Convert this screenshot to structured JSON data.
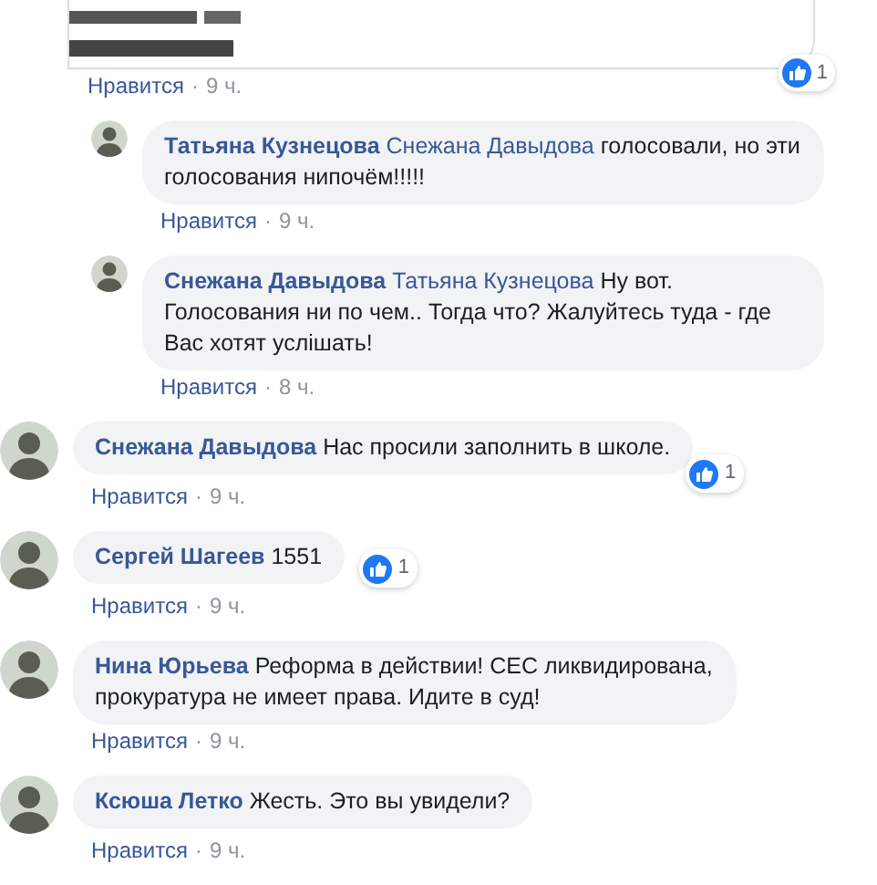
{
  "comments": [
    {
      "kind": "preview",
      "reactions": "1",
      "like": "Нравится",
      "dot": "·",
      "time": "9 ч.",
      "children": [
        {
          "kind": "comment",
          "author": "Татьяна Кузнецова",
          "mention": "Снежана Давыдова",
          "text": "голосовали, но эти голосования нипочём!!!!!",
          "like": "Нравится",
          "dot": "·",
          "time": "9 ч."
        },
        {
          "kind": "comment",
          "author": "Снежана Давыдова",
          "mention": "Татьяна Кузнецова",
          "text": "Ну вот. Голосования ни по чем.. Тогда что? Жалуйтесь туда - где Вас хотят услішать!",
          "like": "Нравится",
          "dot": "·",
          "time": "8 ч."
        }
      ]
    },
    {
      "kind": "comment",
      "author": "Снежана Давыдова",
      "text": "Нас просили заполнить в школе.",
      "reactions": "1",
      "like": "Нравится",
      "dot": "·",
      "time": "9 ч."
    },
    {
      "kind": "comment",
      "author": "Сергей Шагеев",
      "text": "1551",
      "reactions": "1",
      "like": "Нравится",
      "dot": "·",
      "time": "9 ч."
    },
    {
      "kind": "comment",
      "author": "Нина Юрьева",
      "text": "Реформа в действии! СЕС ликвидирована, прокуратура не имеет права. Идите в суд!",
      "like": "Нравится",
      "dot": "·",
      "time": "9 ч."
    },
    {
      "kind": "comment",
      "author": "Ксюша Летко",
      "text": "Жесть. Это вы увидели?",
      "like": "Нравится",
      "dot": "·",
      "time": "9 ч."
    }
  ]
}
